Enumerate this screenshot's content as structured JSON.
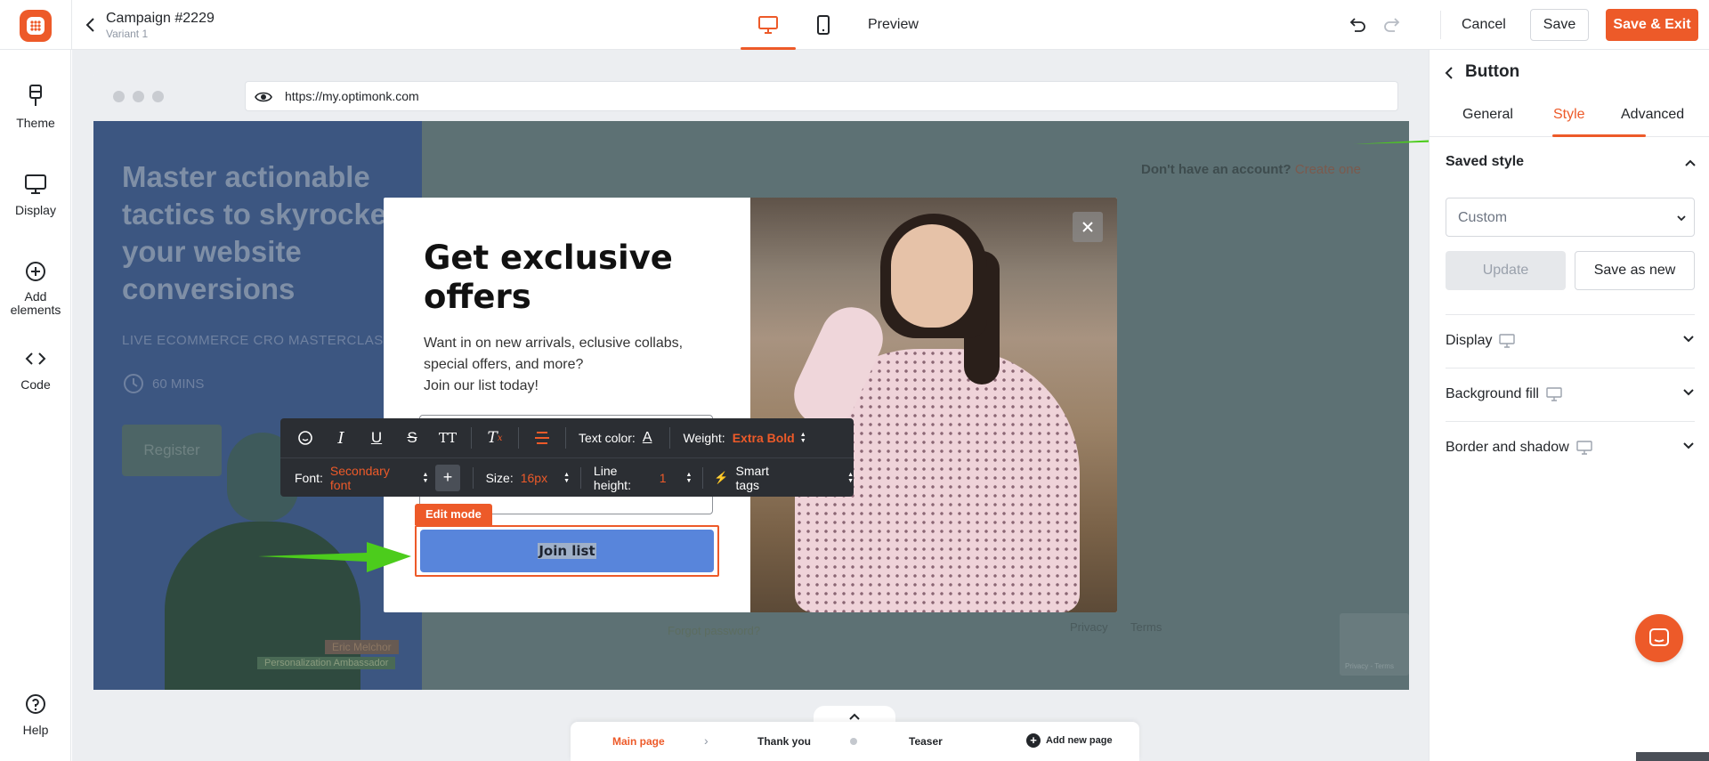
{
  "header": {
    "campaign_title": "Campaign #2229",
    "variant": "Variant 1",
    "preview_label": "Preview",
    "cancel_label": "Cancel",
    "save_label": "Save",
    "save_exit_label": "Save & Exit",
    "accent_color": "#ed5a29"
  },
  "sidebar": {
    "items": [
      {
        "label": "Theme",
        "icon": "brush-icon"
      },
      {
        "label": "Display",
        "icon": "monitor-icon"
      },
      {
        "label": "Add elements",
        "icon": "plus-circle-icon"
      },
      {
        "label": "Code",
        "icon": "code-icon"
      },
      {
        "label": "Help",
        "icon": "help-icon"
      }
    ]
  },
  "browser": {
    "url": "https://my.optimonk.com"
  },
  "site": {
    "hero_title": "Master actionable tactics to skyrocket your website conversions",
    "hero_subtitle": "LIVE ECOMMERCE CRO MASTERCLASS",
    "duration": "60 MINS",
    "register_label": "Register",
    "presenter_name": "Eric Melchor",
    "presenter_role": "Personalization Ambassador",
    "account_prompt": "Don't have an account?",
    "create_link": "Create one",
    "forgot_password": "Forgot password?",
    "privacy": "Privacy",
    "terms": "Terms",
    "recaptcha": "Privacy - Terms"
  },
  "popup": {
    "title": "Get exclusive offers",
    "description_lines": [
      "Want in on new arrivals, eclusive collabs,",
      "special offers, and more?",
      "Join our list today!"
    ],
    "edit_mode_label": "Edit mode",
    "button_label": "Join list",
    "button_color": "#5885db"
  },
  "text_toolbar": {
    "text_color_label": "Text color:",
    "weight_label": "Weight:",
    "weight_value": "Extra Bold",
    "font_label": "Font:",
    "font_value": "Secondary font",
    "size_label": "Size:",
    "size_value": "16px",
    "line_height_label": "Line height:",
    "line_height_value": "1",
    "smart_tags_label": "Smart tags",
    "tt_label": "TT"
  },
  "pages": {
    "main": "Main page",
    "thank_you": "Thank you",
    "teaser": "Teaser",
    "add_new": "Add new page"
  },
  "right_panel": {
    "title": "Button",
    "tabs": [
      "General",
      "Style",
      "Advanced"
    ],
    "active_tab": "Style",
    "saved_style_label": "Saved style",
    "saved_style_value": "Custom",
    "update_label": "Update",
    "save_as_new_label": "Save as new",
    "sections": [
      "Display",
      "Background fill",
      "Border and shadow"
    ]
  }
}
